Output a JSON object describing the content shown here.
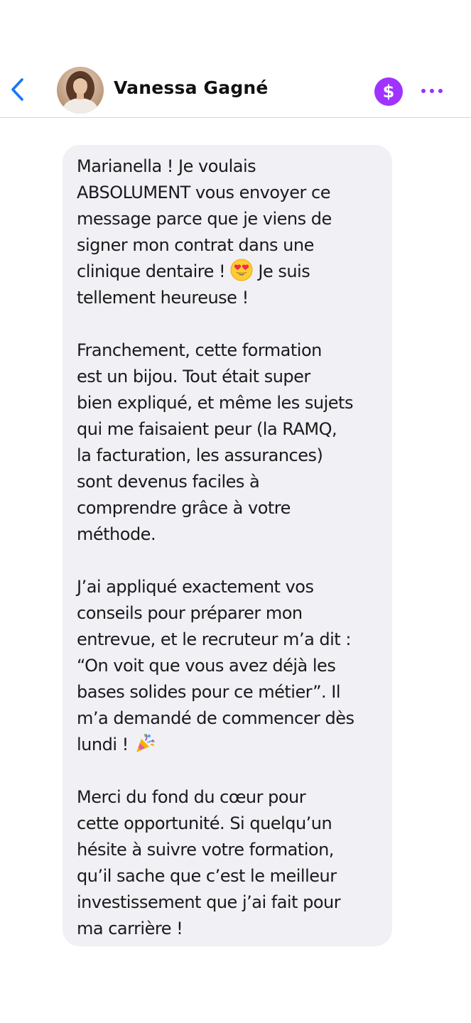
{
  "header": {
    "contact_name": "Vanessa Gagné",
    "back_icon": "chevron-left-icon",
    "pay_symbol": "$",
    "pay_color": "#a033ff",
    "more_icon": "more-horizontal-icon"
  },
  "message": {
    "bubble_color": "#f0f0f5",
    "p1_a": "Marianella ! Je voulais\nABSOLUMENT vous envoyer ce\nmessage parce que je viens de\nsigner mon contrat dans une\nclinique dentaire ! ",
    "p1_emoji": "heart-eyes-emoji",
    "p1_b": " Je suis\ntellement heureuse !",
    "p2": "Franchement, cette formation\nest un bijou. Tout était super\nbien expliqué, et même les sujets\nqui me faisaient peur (la RAMQ,\nla facturation, les assurances)\nsont devenus faciles à\ncomprendre grâce à votre\nméthode.",
    "p3_a": "J’ai appliqué exactement vos\nconseils pour préparer mon\nentrevue, et le recruteur m’a dit :\n“On voit que vous avez déjà les\nbases solides pour ce métier”. Il\nm’a demandé de commencer dès\nlundi ! ",
    "p3_emoji": "party-popper-emoji",
    "p4": "Merci du fond du cœur pour\ncette opportunité. Si quelqu’un\nhésite à suivre votre formation,\nqu’il sache que c’est le meilleur\ninvestissement que j’ai fait pour\nma carrière !"
  }
}
